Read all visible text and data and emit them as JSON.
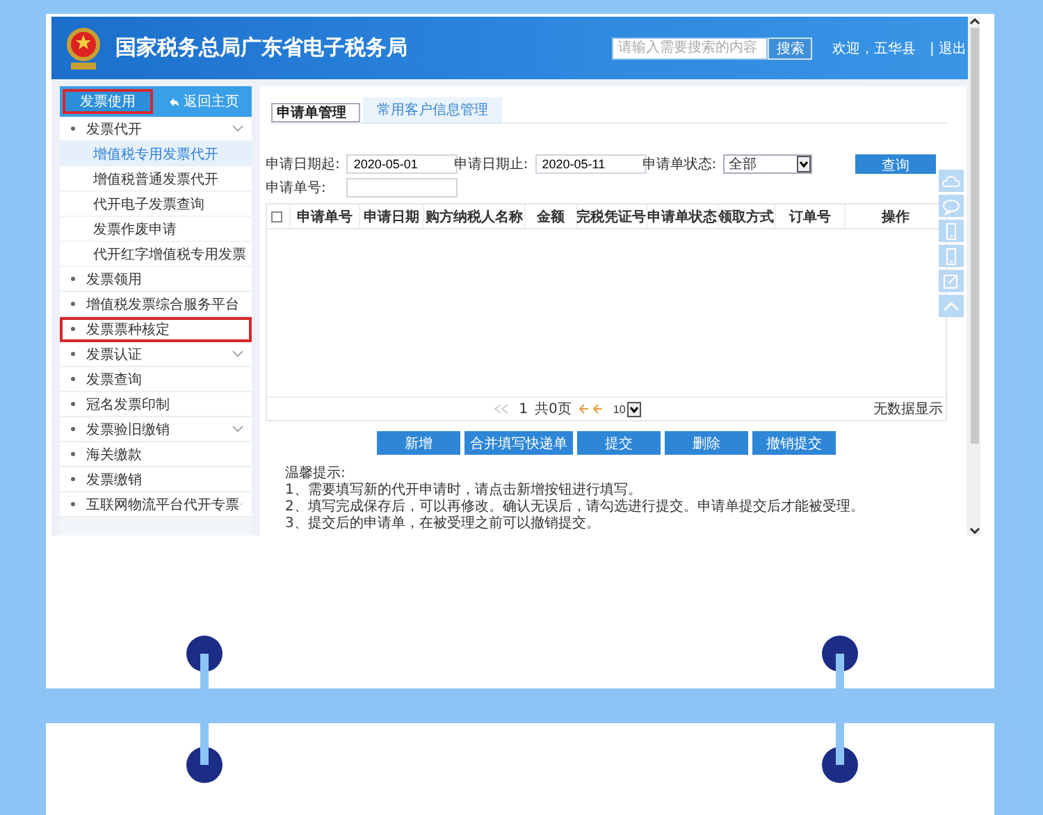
{
  "header": {
    "title": "国家税务总局广东省电子税务局",
    "search": {
      "placeholder": "请输入需要搜索的内容"
    },
    "search_button": "搜索",
    "welcome": "欢迎，五华县",
    "logout": "| 退出"
  },
  "sidebar": {
    "top_buttons": [
      {
        "label": "发票使用",
        "selected": true,
        "highlighted": true
      },
      {
        "label": "返回主页",
        "selected": false,
        "highlighted": false
      }
    ],
    "items": [
      {
        "label": "发票代开",
        "expandable": true,
        "highlighted": false,
        "children": [
          {
            "label": "增值税专用发票代开",
            "selected": true
          },
          {
            "label": "增值税普通发票代开",
            "selected": false
          },
          {
            "label": "代开电子发票查询",
            "selected": false
          },
          {
            "label": "发票作废申请",
            "selected": false
          },
          {
            "label": "代开红字增值税专用发票",
            "selected": false
          }
        ]
      },
      {
        "label": "发票领用",
        "expandable": false,
        "highlighted": false
      },
      {
        "label": "增值税发票综合服务平台",
        "expandable": false,
        "highlighted": false
      },
      {
        "label": "发票票种核定",
        "expandable": false,
        "highlighted": true
      },
      {
        "label": "发票认证",
        "expandable": true,
        "highlighted": false
      },
      {
        "label": "发票查询",
        "expandable": false,
        "highlighted": false
      },
      {
        "label": "冠名发票印制",
        "expandable": false,
        "highlighted": false
      },
      {
        "label": "发票验旧缴销",
        "expandable": true,
        "highlighted": false
      },
      {
        "label": "海关缴款",
        "expandable": false,
        "highlighted": false
      },
      {
        "label": "发票缴销",
        "expandable": false,
        "highlighted": false
      },
      {
        "label": "互联网物流平台代开专票",
        "expandable": true,
        "highlighted": false
      }
    ]
  },
  "main": {
    "tabs": [
      {
        "label": "申请单管理",
        "selected": true
      },
      {
        "label": "常用客户信息管理",
        "selected": false
      }
    ],
    "filters": [
      {
        "label": "申请日期起:",
        "kind": "input",
        "value": "2020-05-01"
      },
      {
        "label": "申请日期止:",
        "kind": "input",
        "value": "2020-05-11"
      },
      {
        "label": "申请单状态:",
        "kind": "select",
        "value": "全部"
      },
      {
        "label": "申请单号:",
        "kind": "input"
      }
    ],
    "query_button": "查询",
    "table": {
      "select_all_checked": false,
      "columns": [
        "申请单号",
        "申请日期",
        "购方纳税人名称",
        "金额",
        "完税凭证号",
        "申请单状态",
        "领取方式",
        "订单号",
        "操作"
      ]
    },
    "pager": {
      "current": "1",
      "total": "共0页",
      "page_size": "10",
      "empty_message": "无数据显示"
    },
    "actions": [
      "新增",
      "合并填写快递单",
      "提交",
      "删除",
      "撤销提交"
    ],
    "notes": {
      "title": "温馨提示:",
      "lines": [
        "1、需要填写新的代开申请时，请点击新增按钮进行填写。",
        "2、填写完成保存后，可以再修改。确认无误后，请勾选进行提交。申请单提交后才能被受理。",
        "3、提交后的申请单，在被受理之前可以撤销提交。"
      ]
    }
  }
}
